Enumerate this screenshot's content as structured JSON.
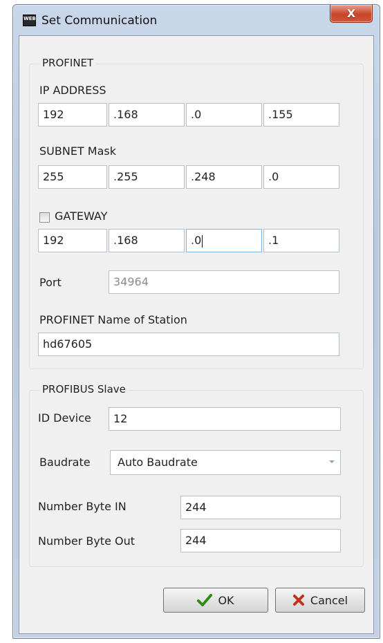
{
  "window": {
    "title": "Set Communication",
    "icon_text": "WEB",
    "close_label": "X"
  },
  "profinet": {
    "legend": "PROFINET",
    "ip_label": "IP ADDRESS",
    "ip": [
      "192",
      "168",
      "0",
      "155"
    ],
    "subnet_label": "SUBNET Mask",
    "subnet": [
      "255",
      "255",
      "248",
      "0"
    ],
    "gateway_label": "GATEWAY",
    "gateway_checked": false,
    "gateway": [
      "192",
      "168",
      "0",
      "1"
    ],
    "port_label": "Port",
    "port": "34964",
    "station_label": "PROFINET Name of Station",
    "station": "hd67605"
  },
  "profibus": {
    "legend": "PROFIBUS Slave",
    "id_label": "ID Device",
    "id": "12",
    "baud_label": "Baudrate",
    "baud": "Auto Baudrate",
    "byte_in_label": "Number Byte IN",
    "byte_in": "244",
    "byte_out_label": "Number Byte Out",
    "byte_out": "244"
  },
  "buttons": {
    "ok": "OK",
    "cancel": "Cancel"
  },
  "colors": {
    "ok_check": "#2f8a1a",
    "cancel_x": "#c0301c",
    "close_button": "#c8432a"
  }
}
